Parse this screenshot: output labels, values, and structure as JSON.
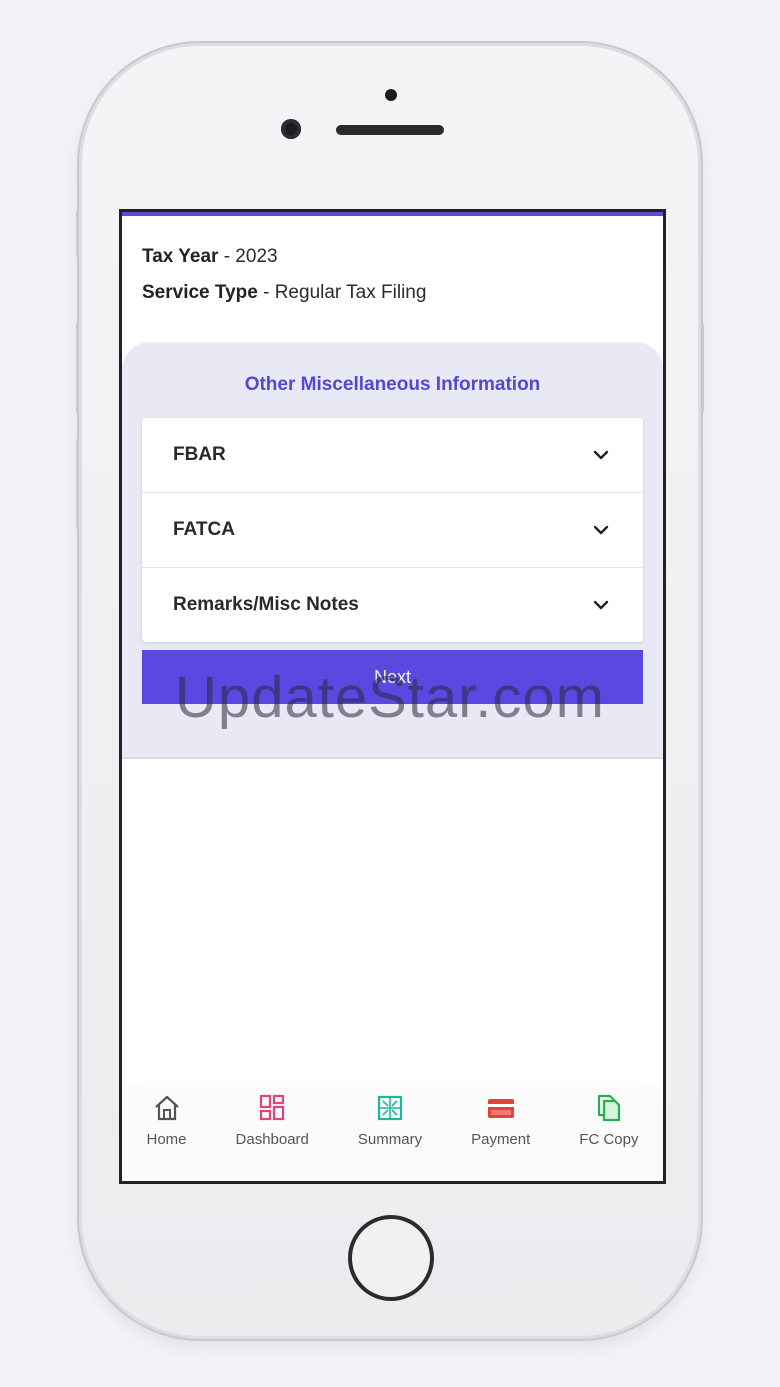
{
  "header": {
    "tax_year_label": "Tax Year",
    "tax_year_value": " - 2023",
    "service_type_label": "Service Type",
    "service_type_value": " - Regular Tax Filing"
  },
  "panel": {
    "title": "Other Miscellaneous Information",
    "items": [
      {
        "label": "FBAR"
      },
      {
        "label": "FATCA"
      },
      {
        "label": "Remarks/Misc Notes"
      }
    ],
    "next_label": "Next"
  },
  "bottom_nav": [
    {
      "label": "Home",
      "icon": "home-icon",
      "color": "#555555"
    },
    {
      "label": "Dashboard",
      "icon": "dashboard-icon",
      "color": "#e2447c"
    },
    {
      "label": "Summary",
      "icon": "summary-icon",
      "color": "#1fb79a"
    },
    {
      "label": "Payment",
      "icon": "credit-card-icon",
      "color": "#e8413a"
    },
    {
      "label": "FC Copy",
      "icon": "copy-icon",
      "color": "#22b14c"
    }
  ],
  "watermark": "UpdateStar.com",
  "colors": {
    "accent": "#5a48e0",
    "title": "#5647cf",
    "panel_bg": "#e8e9f5"
  }
}
